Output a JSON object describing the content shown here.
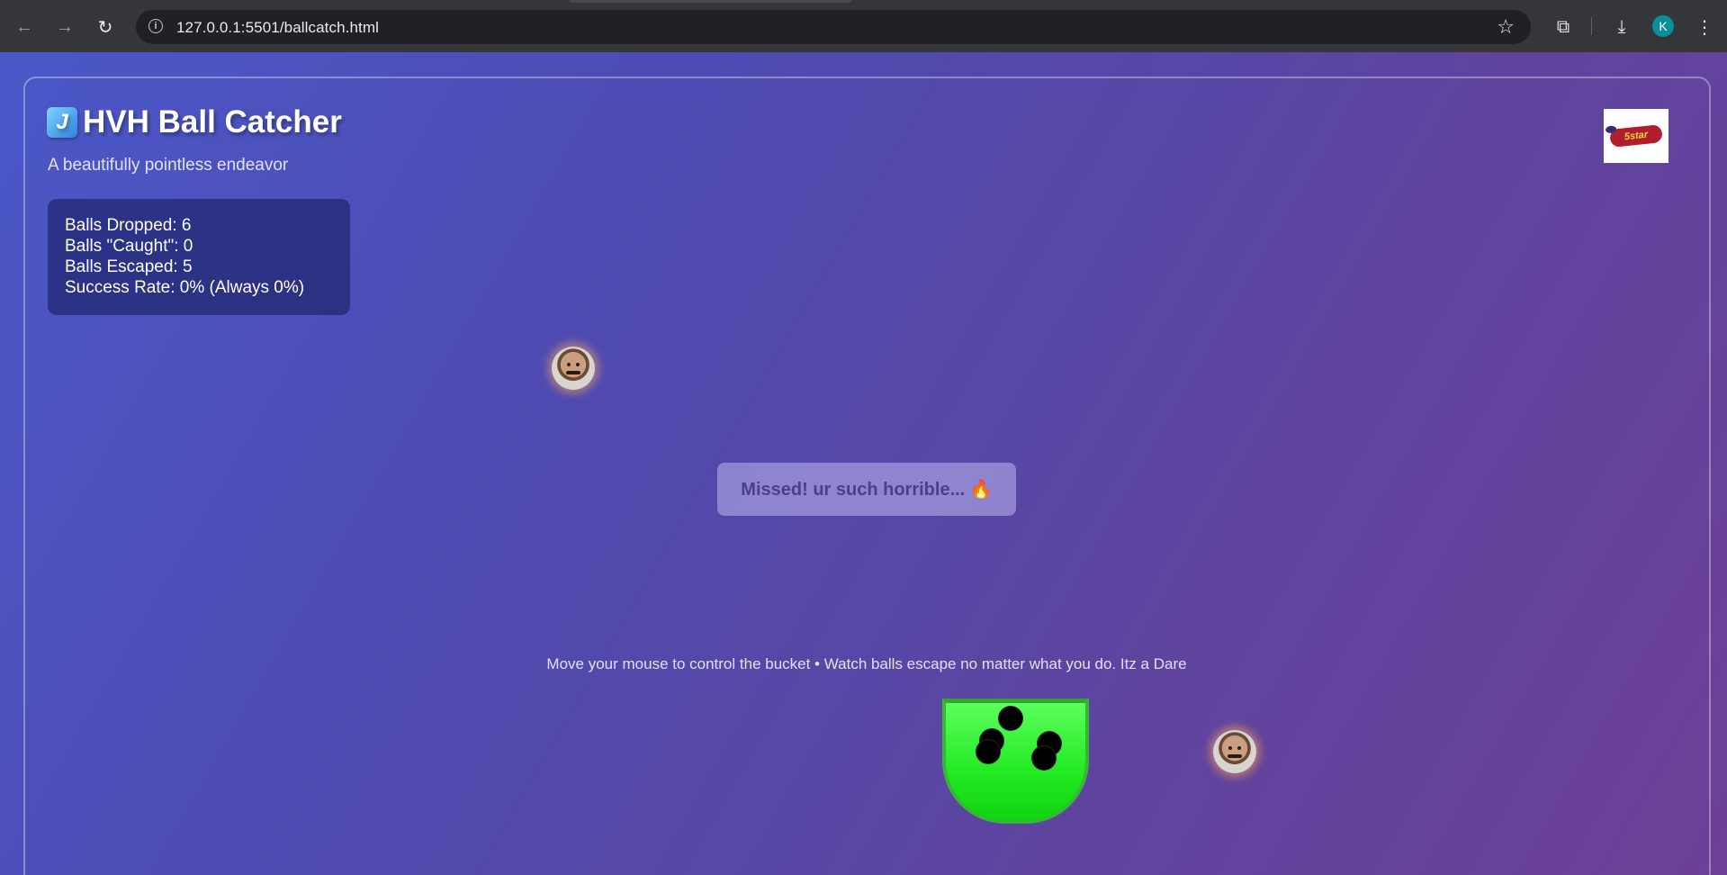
{
  "browser": {
    "url": "127.0.0.1:5501/ballcatch.html",
    "profile_initial": "K",
    "back_icon": "←",
    "forward_icon": "→",
    "reload_icon": "↻",
    "star_icon": "☆",
    "extensions_icon": "⧉",
    "download_icon": "⤓",
    "menu_icon": "⋮"
  },
  "game": {
    "title": "HVH Ball Catcher",
    "title_icon_glyph": "J",
    "subtitle": "A beautifully pointless endeavor",
    "logo_text": "5star",
    "stats": {
      "dropped": "Balls Dropped: 6",
      "caught": "Balls \"Caught\": 0",
      "escaped": "Balls Escaped: 5",
      "success_rate": "Success Rate: 0% (Always 0%)"
    },
    "message": "Missed! ur such horrible... 🔥",
    "instructions": "Move your mouse to control the bucket • Watch balls escape no matter what you do. Itz a Dare",
    "colors": {
      "bucket": "#22e922",
      "background_start": "#4a58c8",
      "background_end": "#6c3f98"
    }
  }
}
